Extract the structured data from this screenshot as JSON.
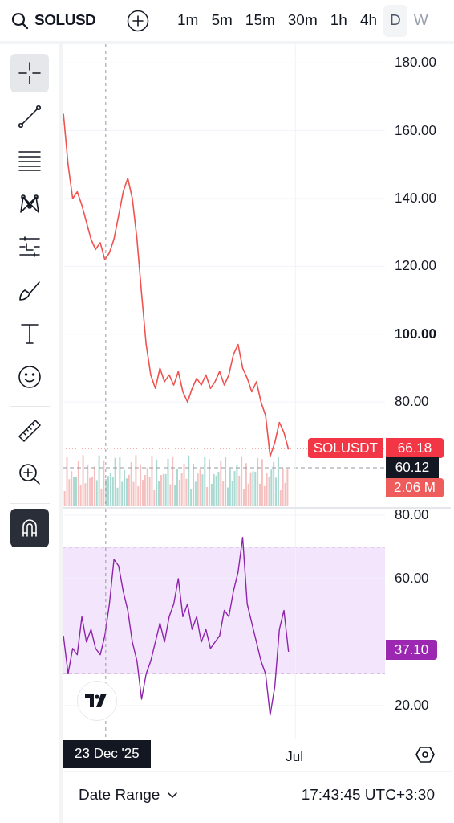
{
  "top_bar": {
    "symbol": "SOLUSD",
    "intervals": [
      {
        "label": "1m",
        "selected": false,
        "dimmed": false
      },
      {
        "label": "5m",
        "selected": false,
        "dimmed": false
      },
      {
        "label": "15m",
        "selected": false,
        "dimmed": false
      },
      {
        "label": "30m",
        "selected": false,
        "dimmed": false
      },
      {
        "label": "1h",
        "selected": false,
        "dimmed": false
      },
      {
        "label": "4h",
        "selected": false,
        "dimmed": false
      },
      {
        "label": "D",
        "selected": true,
        "dimmed": false
      },
      {
        "label": "W",
        "selected": false,
        "dimmed": true
      }
    ]
  },
  "toolbar": {
    "tools": [
      {
        "kind": "crosshair",
        "selected": true
      },
      {
        "kind": "trend-line",
        "selected": false
      },
      {
        "kind": "fib",
        "selected": false
      },
      {
        "kind": "pattern",
        "selected": false
      },
      {
        "kind": "position",
        "selected": false
      },
      {
        "kind": "brush",
        "selected": false
      },
      {
        "kind": "text",
        "selected": false
      },
      {
        "kind": "emoji",
        "selected": false
      },
      {
        "kind": "divider"
      },
      {
        "kind": "ruler",
        "selected": false
      },
      {
        "kind": "zoom",
        "selected": false
      },
      {
        "kind": "divider"
      },
      {
        "kind": "magnet",
        "selected": true
      }
    ]
  },
  "price_pane": {
    "chart_data": {
      "type": "line",
      "categories": [
        null,
        null,
        null,
        null,
        null,
        null,
        null,
        null,
        null,
        null,
        null,
        null,
        null,
        null,
        null,
        null,
        null,
        null,
        null,
        null,
        null,
        null,
        null,
        null,
        null,
        null,
        null,
        null,
        null,
        null,
        null,
        null,
        null,
        null,
        null,
        null,
        null,
        null,
        null,
        null,
        null,
        null,
        null,
        null,
        null,
        null,
        null,
        null,
        null,
        null
      ],
      "series": [
        {
          "name": "SOLUSDT",
          "color": "#ef5350",
          "values": [
            165,
            150,
            140,
            142,
            138,
            133,
            128,
            125,
            127,
            122,
            124,
            128,
            135,
            142,
            146,
            140,
            128,
            112,
            97,
            88,
            84,
            90,
            86,
            88,
            85,
            89,
            83,
            80,
            84,
            87,
            85,
            88,
            84,
            86,
            89,
            85,
            88,
            94,
            97,
            90,
            87,
            83,
            86,
            80,
            76,
            64,
            68,
            74,
            71,
            66
          ]
        }
      ],
      "ylim": [
        49,
        185.5
      ],
      "grid": true,
      "yticks": [
        {
          "value": 80,
          "label": "80.00"
        },
        {
          "value": 100,
          "label": "100.00"
        },
        {
          "value": 120,
          "label": "120.00"
        },
        {
          "value": 140,
          "label": "140.00"
        },
        {
          "value": 160,
          "label": "160.00"
        },
        {
          "value": 180,
          "label": "180.00"
        }
      ]
    },
    "last_price": "66.18",
    "crosshair_price": "60.12",
    "volume": "2.06 M"
  },
  "rsi_pane": {
    "chart_data": {
      "type": "line",
      "categories": [
        null,
        null,
        null,
        null,
        null,
        null,
        null,
        null,
        null,
        null,
        null,
        null,
        null,
        null,
        null,
        null,
        null,
        null,
        null,
        null,
        null,
        null,
        null,
        null,
        null,
        null,
        null,
        null,
        null,
        null,
        null,
        null,
        null,
        null,
        null,
        null,
        null,
        null,
        null,
        null,
        null,
        null,
        null,
        null,
        null,
        null,
        null,
        null,
        null,
        null
      ],
      "series": [
        {
          "color": "#8e24aa",
          "values": [
            42,
            30,
            38,
            36,
            48,
            40,
            44,
            38,
            36,
            42,
            52,
            66,
            64,
            56,
            50,
            40,
            34,
            22,
            30,
            34,
            40,
            46,
            40,
            48,
            52,
            60,
            48,
            52,
            44,
            48,
            40,
            44,
            38,
            40,
            42,
            50,
            48,
            56,
            62,
            73,
            52,
            46,
            40,
            34,
            30,
            17,
            26,
            44,
            50,
            37
          ]
        }
      ],
      "ylim": [
        9.6,
        82
      ],
      "grid": true,
      "yticks": [
        {
          "value": 20,
          "label": "20.00"
        },
        {
          "value": 60,
          "label": "60.00"
        },
        {
          "value": 80,
          "label": "80.00"
        }
      ]
    },
    "last_value": "37.10"
  },
  "time_axis": {
    "crosshair_label": "23 Dec '25",
    "labels": [
      "Jul"
    ]
  },
  "bottom_bar": {
    "date_range": "Date Range",
    "time": "17:43:45 UTC+3:30"
  }
}
